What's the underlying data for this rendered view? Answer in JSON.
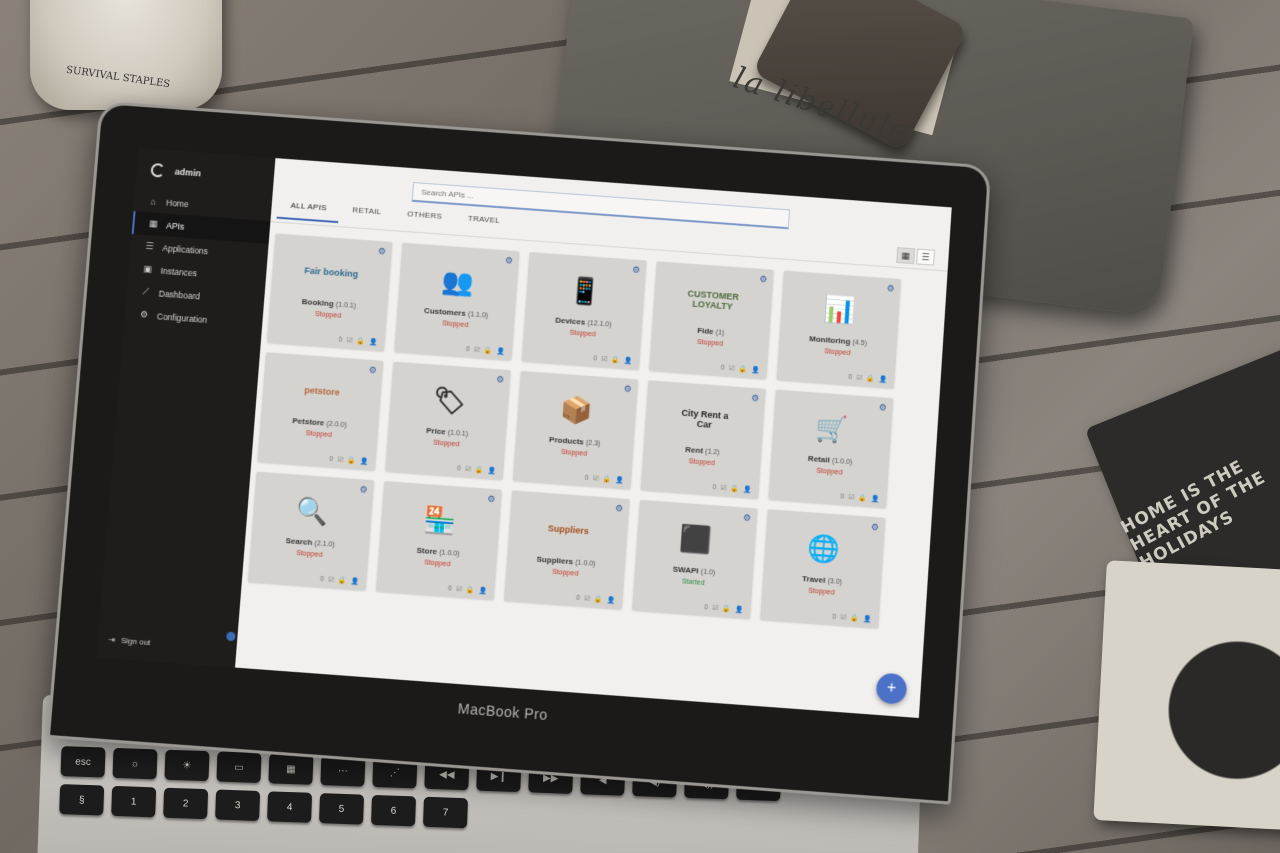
{
  "scene": {
    "jar_label": "SURVIVAL STAPLES",
    "pouch_text": "la libellule",
    "coaster_text": "HOME IS THE HEART OF THE HOLIDAYS",
    "laptop_brand": "MacBook Pro"
  },
  "sidebar": {
    "user": "admin",
    "items": [
      {
        "label": "Home",
        "icon": "home-icon"
      },
      {
        "label": "APIs",
        "icon": "apis-icon"
      },
      {
        "label": "Applications",
        "icon": "list-icon"
      },
      {
        "label": "Instances",
        "icon": "instances-icon"
      },
      {
        "label": "Dashboard",
        "icon": "chart-line-icon"
      },
      {
        "label": "Configuration",
        "icon": "gear-icon"
      }
    ],
    "signout": "Sign out"
  },
  "search": {
    "placeholder": "Search APIs ..."
  },
  "tabs": [
    {
      "label": "ALL APIS"
    },
    {
      "label": "RETAIL"
    },
    {
      "label": "OTHERS"
    },
    {
      "label": "TRAVEL"
    }
  ],
  "apis": [
    {
      "name": "Booking",
      "version": "(1.0.1)",
      "status": "Stopped",
      "logo": "Fair booking",
      "color": "#2c6a8f"
    },
    {
      "name": "Customers",
      "version": "(1.1.0)",
      "status": "Stopped",
      "logo": "👥",
      "color": "#7a2f5b"
    },
    {
      "name": "Devices",
      "version": "(12.1.0)",
      "status": "Stopped",
      "logo": "📱",
      "color": "#3b73a8"
    },
    {
      "name": "Fide",
      "version": "(1)",
      "status": "Stopped",
      "logo": "CUSTOMER LOYALTY",
      "color": "#4e6b3c"
    },
    {
      "name": "Monitoring",
      "version": "(4.5)",
      "status": "Stopped",
      "logo": "📊",
      "color": "#1d1d1d"
    },
    {
      "name": "Petstore",
      "version": "(2.0.0)",
      "status": "Stopped",
      "logo": "petstore",
      "color": "#b3683c"
    },
    {
      "name": "Price",
      "version": "(1.0.1)",
      "status": "Stopped",
      "logo": "🏷",
      "color": "#333333"
    },
    {
      "name": "Products",
      "version": "(2.3)",
      "status": "Stopped",
      "logo": "📦",
      "color": "#222222"
    },
    {
      "name": "Rent",
      "version": "(1.2)",
      "status": "Stopped",
      "logo": "City Rent a Car",
      "color": "#1d1d1d"
    },
    {
      "name": "Retail",
      "version": "(1.0.0)",
      "status": "Stopped",
      "logo": "🛒",
      "color": "#2b5f93"
    },
    {
      "name": "Search",
      "version": "(2.1.0)",
      "status": "Stopped",
      "logo": "🔍",
      "color": "#222222"
    },
    {
      "name": "Store",
      "version": "(1.0.0)",
      "status": "Stopped",
      "logo": "🏪",
      "color": "#2f5c8f"
    },
    {
      "name": "Suppliers",
      "version": "(1.0.0)",
      "status": "Stopped",
      "logo": "Suppliers",
      "color": "#a34f1c"
    },
    {
      "name": "SWAPI",
      "version": "(1.0)",
      "status": "Started",
      "logo": "⬛",
      "color": "#111111"
    },
    {
      "name": "Travel",
      "version": "(3.0)",
      "status": "Stopped",
      "logo": "🌐",
      "color": "#2f5c8f"
    }
  ],
  "card_footer_icons": "0 ☑ 🔒 👤",
  "fab_label": "+"
}
